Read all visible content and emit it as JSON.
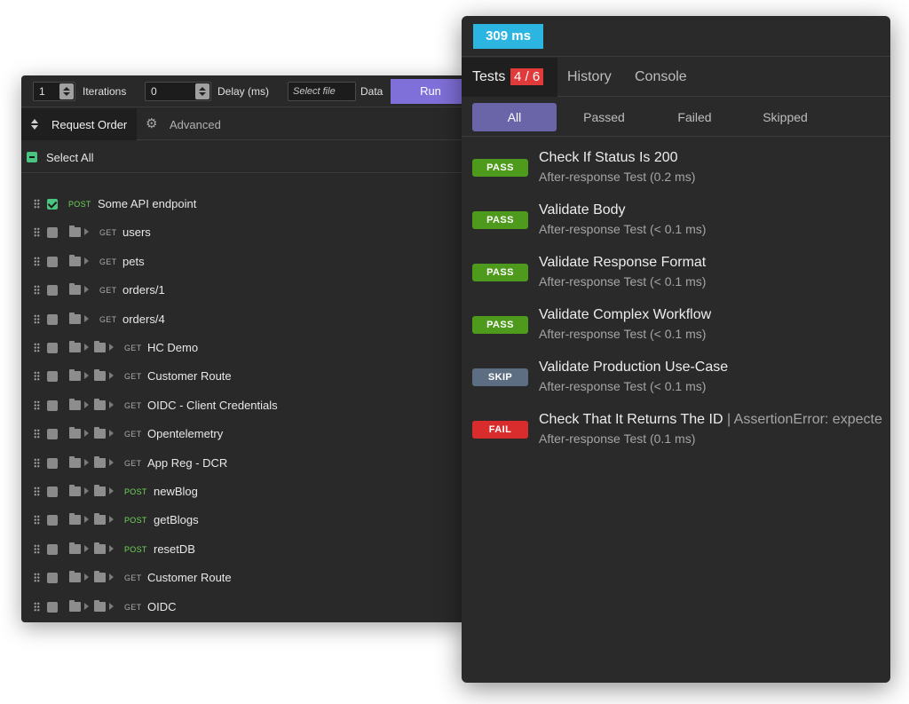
{
  "runner": {
    "iterations_value": "1",
    "iterations_label": "Iterations",
    "delay_value": "0",
    "delay_label": "Delay (ms)",
    "file_placeholder": "Select file",
    "data_label": "Data",
    "run_label": "Run",
    "tab_order": "Request Order",
    "tab_advanced": "Advanced",
    "select_all": "Select All",
    "requests": [
      {
        "method": "POST",
        "name": "Some API endpoint",
        "depth": 0,
        "checked": true
      },
      {
        "method": "GET",
        "name": "users",
        "depth": 1,
        "checked": false
      },
      {
        "method": "GET",
        "name": "pets",
        "depth": 1,
        "checked": false
      },
      {
        "method": "GET",
        "name": "orders/1",
        "depth": 1,
        "checked": false
      },
      {
        "method": "GET",
        "name": "orders/4",
        "depth": 1,
        "checked": false
      },
      {
        "method": "GET",
        "name": "HC Demo",
        "depth": 2,
        "checked": false
      },
      {
        "method": "GET",
        "name": "Customer Route",
        "depth": 2,
        "checked": false
      },
      {
        "method": "GET",
        "name": "OIDC - Client Credentials",
        "depth": 2,
        "checked": false
      },
      {
        "method": "GET",
        "name": "Opentelemetry",
        "depth": 2,
        "checked": false
      },
      {
        "method": "GET",
        "name": "App Reg - DCR",
        "depth": 2,
        "checked": false
      },
      {
        "method": "POST",
        "name": "newBlog",
        "depth": 2,
        "checked": false
      },
      {
        "method": "POST",
        "name": "getBlogs",
        "depth": 2,
        "checked": false
      },
      {
        "method": "POST",
        "name": "resetDB",
        "depth": 2,
        "checked": false
      },
      {
        "method": "GET",
        "name": "Customer Route",
        "depth": 2,
        "checked": false
      },
      {
        "method": "GET",
        "name": "OIDC",
        "depth": 2,
        "checked": false
      }
    ]
  },
  "results": {
    "time_badge": "309 ms",
    "tabs": {
      "tests": "Tests",
      "tests_count": "4 / 6",
      "history": "History",
      "console": "Console"
    },
    "filters": {
      "all": "All",
      "passed": "Passed",
      "failed": "Failed",
      "skipped": "Skipped"
    },
    "tests": [
      {
        "status": "PASS",
        "title": "Check If Status Is 200",
        "error": "",
        "sub": "After-response Test (0.2 ms)"
      },
      {
        "status": "PASS",
        "title": "Validate Body",
        "error": "",
        "sub": "After-response Test (< 0.1 ms)"
      },
      {
        "status": "PASS",
        "title": "Validate Response Format",
        "error": "",
        "sub": "After-response Test (< 0.1 ms)"
      },
      {
        "status": "PASS",
        "title": "Validate Complex Workflow",
        "error": "",
        "sub": "After-response Test (< 0.1 ms)"
      },
      {
        "status": "SKIP",
        "title": "Validate Production Use-Case",
        "error": "",
        "sub": "After-response Test (< 0.1 ms)"
      },
      {
        "status": "FAIL",
        "title": "Check That It Returns The ID",
        "error": " | AssertionError: expecte",
        "sub": "After-response Test (0.1 ms)"
      }
    ],
    "colors": {
      "pass": "#4e9a1c",
      "skip": "#5e6e82",
      "fail": "#d92d2d",
      "badge": "#2bb5e0",
      "run": "#7f6fd8"
    }
  }
}
